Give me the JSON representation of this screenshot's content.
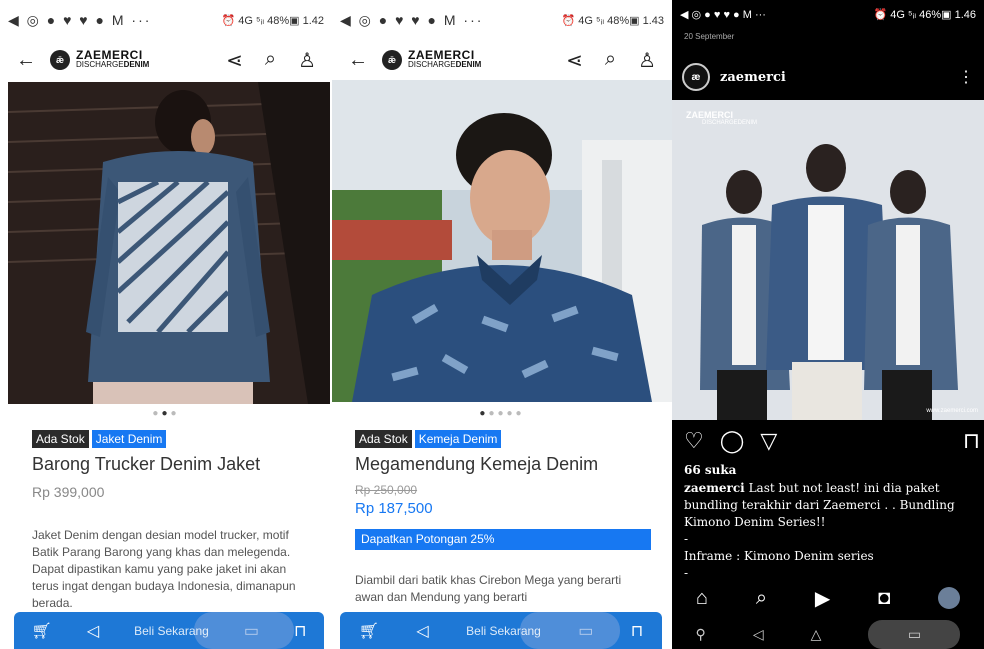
{
  "panel1": {
    "status": {
      "icons": "◀ ◎ ● ♥ ♥ ● M ···",
      "right": "⏰ 4G ⁵ᵢₗ 48%▣ 1.42"
    },
    "brand": {
      "line1": "ZAEMERCI",
      "line2a": "DISCHARGE",
      "line2b": "DENIM",
      "mark": "ǣ"
    },
    "dots": {
      "left": "●",
      "active": "●",
      "right": "●"
    },
    "tags": [
      "Ada Stok",
      "Jaket Denim"
    ],
    "title": "Barong Trucker Denim Jaket",
    "price": "Rp 399,000",
    "description": "Jaket Denim dengan desian model trucker, motif Batik Parang Barong yang khas dan melegenda. Dapat dipastikan kamu yang pake jaket ini akan terus ingat dengan budaya Indonesia, dimanapun berada.",
    "bottom_bar": {
      "cta": "Beli Sekarang"
    }
  },
  "panel2": {
    "status": {
      "icons": "◀ ◎ ● ♥ ♥ ● M ···",
      "right": "⏰ 4G ⁵ᵢₗ 48%▣ 1.43"
    },
    "dots": {
      "active": "●",
      "rest": "●●●●"
    },
    "tags": [
      "Ada Stok",
      "Kemeja Denim"
    ],
    "title": "Megamendung Kemeja Denim",
    "old_price": "Rp 250,000",
    "price": "Rp 187,500",
    "promo": "Dapatkan Potongan 25%",
    "description": "Diambil dari batik khas Cirebon Mega yang berarti awan dan Mendung yang berarti",
    "bottom_bar": {
      "cta": "Beli Sekarang"
    }
  },
  "panel3": {
    "status": {
      "icons": "◀ ◎ ● ♥ ♥ ● M ···",
      "right": "⏰ 4G ⁵ᵢₗ 46%▣ 1.46"
    },
    "date": "20 September",
    "username": "zaemerci",
    "photo_brand": "ZAEMERCI",
    "photo_brand2": "DISCHARGEDENIM",
    "photo_url": "www.zaemerci.com",
    "likes": "66 suka",
    "caption_user": "zaemerci",
    "caption": " Last but not least! ini dia paket bundling terakhir dari Zaemerci . . Bundling Kimono Denim Series!!",
    "caption_dash1": "-",
    "caption_line2": "Inframe :  Kimono Denim series",
    "caption_dash2": "-"
  },
  "colors": {
    "accent": "#1778f2",
    "tag_dark": "#2b2b2b",
    "nav_bar": "#1e78d6"
  }
}
